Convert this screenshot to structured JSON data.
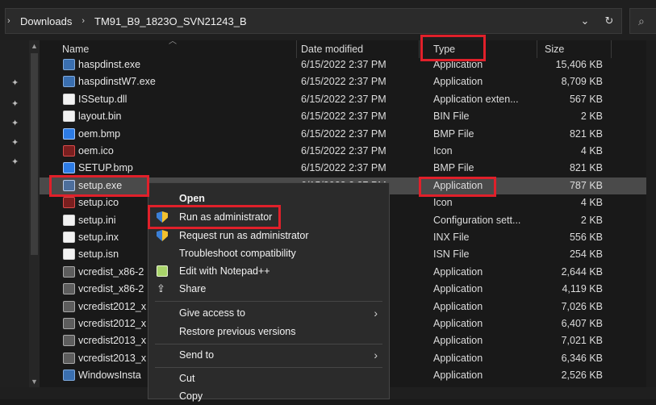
{
  "address_bar": {
    "crumbs": [
      "Downloads",
      "TM91_B9_1823O_SVN21243_B"
    ],
    "separator_glyph": "›",
    "dropdown_glyph": "⌄",
    "refresh_glyph": "↻",
    "search_glyph": "⌕"
  },
  "columns": {
    "name": "Name",
    "date": "Date modified",
    "type": "Type",
    "size": "Size"
  },
  "files": [
    {
      "name": "haspdinst.exe",
      "date": "6/15/2022 2:37 PM",
      "type": "Application",
      "size": "15,406 KB",
      "icon": "app-icon"
    },
    {
      "name": "haspdinstW7.exe",
      "date": "6/15/2022 2:37 PM",
      "type": "Application",
      "size": "8,709 KB",
      "icon": "app-icon"
    },
    {
      "name": "ISSetup.dll",
      "date": "6/15/2022 2:37 PM",
      "type": "Application exten...",
      "size": "567 KB",
      "icon": "dll-icon"
    },
    {
      "name": "layout.bin",
      "date": "6/15/2022 2:37 PM",
      "type": "BIN File",
      "size": "2 KB",
      "icon": "file-icon"
    },
    {
      "name": "oem.bmp",
      "date": "6/15/2022 2:37 PM",
      "type": "BMP File",
      "size": "821 KB",
      "icon": "bmp-icon"
    },
    {
      "name": "oem.ico",
      "date": "6/15/2022 2:37 PM",
      "type": "Icon",
      "size": "4 KB",
      "icon": "ico-icon"
    },
    {
      "name": "SETUP.bmp",
      "date": "6/15/2022 2:37 PM",
      "type": "BMP File",
      "size": "821 KB",
      "icon": "bmp-icon"
    },
    {
      "name": "setup.exe",
      "date": "6/15/2022 2:37 PM",
      "type": "Application",
      "size": "787 KB",
      "icon": "setup-icon"
    },
    {
      "name": "setup.ico",
      "date": "",
      "type": "Icon",
      "size": "4 KB",
      "icon": "ico-icon"
    },
    {
      "name": "setup.ini",
      "date": "",
      "type": "Configuration sett...",
      "size": "2 KB",
      "icon": "ini-icon"
    },
    {
      "name": "setup.inx",
      "date": "",
      "type": "INX File",
      "size": "556 KB",
      "icon": "file-icon"
    },
    {
      "name": "setup.isn",
      "date": "",
      "type": "ISN File",
      "size": "254 KB",
      "icon": "file-icon"
    },
    {
      "name": "vcredist_x86-2",
      "date": "",
      "type": "Application",
      "size": "2,644 KB",
      "icon": "vc-icon"
    },
    {
      "name": "vcredist_x86-2",
      "date": "",
      "type": "Application",
      "size": "4,119 KB",
      "icon": "vc-icon"
    },
    {
      "name": "vcredist2012_x",
      "date": "",
      "type": "Application",
      "size": "7,026 KB",
      "icon": "vc-icon"
    },
    {
      "name": "vcredist2012_x",
      "date": "",
      "type": "Application",
      "size": "6,407 KB",
      "icon": "vc-icon"
    },
    {
      "name": "vcredist2013_x",
      "date": "",
      "type": "Application",
      "size": "7,021 KB",
      "icon": "vc-icon"
    },
    {
      "name": "vcredist2013_x",
      "date": "",
      "type": "Application",
      "size": "6,346 KB",
      "icon": "vc-icon"
    },
    {
      "name": "WindowsInsta",
      "date": "",
      "type": "Application",
      "size": "2,526 KB",
      "icon": "app-icon"
    }
  ],
  "context_menu": {
    "items": [
      {
        "label": "Open",
        "icon": ""
      },
      {
        "label": "Run as administrator",
        "icon": "uac-shield-icon"
      },
      {
        "label": "Request run as administrator",
        "icon": "uac-shield-icon"
      },
      {
        "label": "Troubleshoot compatibility",
        "icon": ""
      },
      {
        "label": "Edit with Notepad++",
        "icon": "notepadpp-icon"
      },
      {
        "label": "Share",
        "icon": "share-icon"
      },
      {
        "label": "Give access to",
        "icon": "",
        "submenu": true
      },
      {
        "label": "Restore previous versions",
        "icon": ""
      },
      {
        "label": "Send to",
        "icon": "",
        "submenu": true
      },
      {
        "label": "Cut",
        "icon": ""
      },
      {
        "label": "Copy",
        "icon": ""
      }
    ],
    "submenu_glyph": "›"
  },
  "highlight_color": "#e0202a",
  "selection_color": "#4a4a4a",
  "visible_partial_date": "6/15/2022 2:37 PM"
}
